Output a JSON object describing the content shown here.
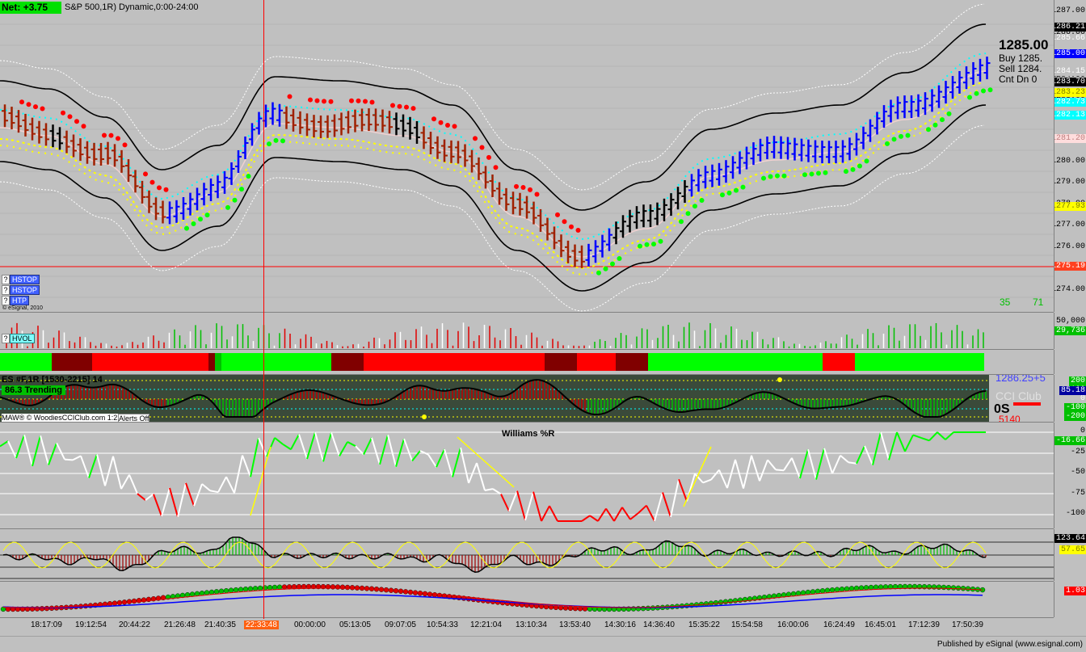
{
  "header": {
    "net_label": "Net:",
    "net_value": "+3.75",
    "title": "S&P 500,1R) Dynamic,0:00-24:00"
  },
  "quote": {
    "last": "1285.00",
    "buy": "Buy  1285.",
    "sell": "Sell   1284.",
    "count": "Cnt Dn    0"
  },
  "price_pane": {
    "scale_ticks": [
      "1287.00",
      "1286.00",
      "1285.00",
      "1284.00",
      "1283.00",
      "1282.00",
      "1281.00",
      "1280.00",
      "1279.00",
      "1278.00",
      "1277.00",
      "1276.00",
      "1275.00",
      "1274.00"
    ],
    "markers": [
      {
        "value": "1286.21",
        "bg": "#000000",
        "fg": "#ffffff"
      },
      {
        "value": "1285.66",
        "bg": "#c0c0c0",
        "fg": "#ffffff"
      },
      {
        "value": "1285.00",
        "bg": "#0000ff",
        "fg": "#ffffff"
      },
      {
        "value": "1284.15",
        "bg": "#c0c0c0",
        "fg": "#ffffff"
      },
      {
        "value": "1283.70",
        "bg": "#000000",
        "fg": "#ffffff"
      },
      {
        "value": "1283.23",
        "bg": "#ffff00",
        "fg": "#808000"
      },
      {
        "value": "1282.73",
        "bg": "#00ffff",
        "fg": "#ffffff"
      },
      {
        "value": "1282.13",
        "bg": "#00ffff",
        "fg": "#ffffff"
      },
      {
        "value": "1281.20",
        "bg": "#ffdddd",
        "fg": "#c08080"
      },
      {
        "value": "1277.93",
        "bg": "#ffff00",
        "fg": "#808000"
      },
      {
        "value": "1275.19",
        "bg": "#ff4020",
        "fg": "#ffffff"
      }
    ],
    "buttons": [
      "HSTOP",
      "HSTOP",
      "HTP"
    ],
    "copyright": "© eSignal, 2010",
    "counts": [
      "35",
      "71"
    ]
  },
  "volume_pane": {
    "label": "HVOL",
    "scale_top": "50,000",
    "marker": "29,736"
  },
  "cci_pane": {
    "title": "ES #F,1R [1530-2215] 14",
    "status": "86.3 Trending",
    "footer": "MAW® © WoodiesCCIClub.com 1:21",
    "alerts": "Alerts Off",
    "watermark": "CCI Club",
    "value_top": "1286.25+5",
    "marker": "85.18",
    "zero_label": "0S",
    "red_num": "5140",
    "scale": [
      "200",
      "100",
      "0",
      "-100",
      "-200"
    ]
  },
  "williams_pane": {
    "title": "Williams %R",
    "scale": [
      "0",
      "-25",
      "-50",
      "-75",
      "-100"
    ],
    "marker": "-16.66"
  },
  "hist_pane": {
    "marker1": "123.64",
    "marker2": "57.65"
  },
  "dots_pane": {
    "marker": "1.03"
  },
  "time_axis": {
    "labels": [
      "18:17:09",
      "19:12:54",
      "20:44:22",
      "21:26:48",
      "21:40:35",
      "22:33:48",
      "00:00:00",
      "05:13:05",
      "09:07:05",
      "10:54:33",
      "12:21:04",
      "13:10:34",
      "13:53:40",
      "14:30:16",
      "14:36:40",
      "15:35:22",
      "15:54:58",
      "16:00:06",
      "16:24:49",
      "16:45:01",
      "17:12:39",
      "17:50:39"
    ],
    "highlight_index": 5
  },
  "footer": {
    "credit": "Published by eSignal (www.esignal.com)"
  },
  "colors": {
    "up": "#0000ff",
    "down": "#a02000",
    "neutral": "#000000",
    "green": "#00ff00",
    "red": "#ff0000",
    "darkred": "#800000",
    "cursor": "#ff0000"
  }
}
